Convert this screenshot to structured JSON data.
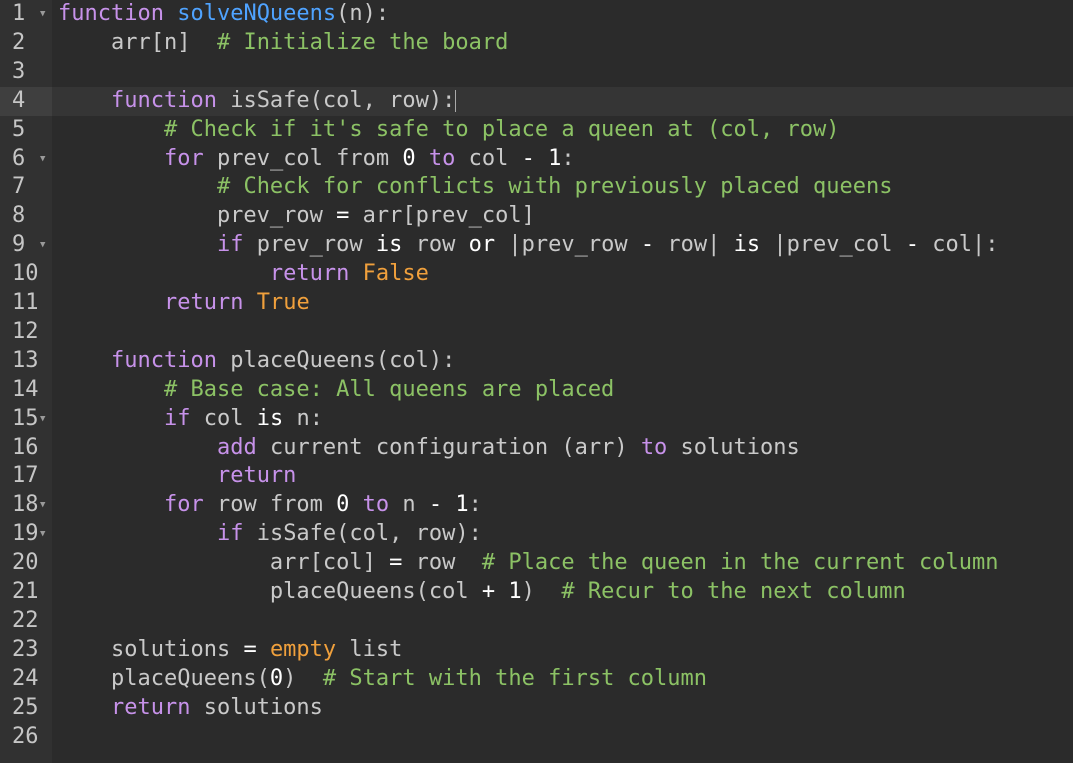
{
  "editor": {
    "colors": {
      "background": "#2b2b2b",
      "gutter": "#313131",
      "keyword": "#c792ea",
      "function_name": "#4fa3ff",
      "comment": "#8cc265",
      "literal": "#f0a03c",
      "operator": "#ffffff",
      "default": "#c9c9c9"
    },
    "active_line": 4,
    "folded_markers": [
      1,
      6,
      9,
      15,
      18,
      19
    ],
    "lines": [
      {
        "number": "1",
        "tokens": [
          [
            "kw",
            "function"
          ],
          [
            "d",
            " "
          ],
          [
            "fn",
            "solveNQueens"
          ],
          [
            "d",
            "(n):"
          ]
        ]
      },
      {
        "number": "2",
        "tokens": [
          [
            "d",
            "    arr[n]  "
          ],
          [
            "cm",
            "# Initialize the board"
          ]
        ]
      },
      {
        "number": "3",
        "tokens": []
      },
      {
        "number": "4",
        "tokens": [
          [
            "d",
            "    "
          ],
          [
            "kw",
            "function"
          ],
          [
            "d",
            " isSafe(col, row):"
          ]
        ]
      },
      {
        "number": "5",
        "tokens": [
          [
            "d",
            "        "
          ],
          [
            "cm",
            "# Check if it's safe to place a queen at (col, row)"
          ]
        ]
      },
      {
        "number": "6",
        "tokens": [
          [
            "d",
            "        "
          ],
          [
            "kw",
            "for"
          ],
          [
            "d",
            " prev_col from "
          ],
          [
            "w",
            "0"
          ],
          [
            "d",
            " "
          ],
          [
            "kw",
            "to"
          ],
          [
            "d",
            " col "
          ],
          [
            "w",
            "-"
          ],
          [
            "d",
            " "
          ],
          [
            "w",
            "1"
          ],
          [
            "d",
            ":"
          ]
        ]
      },
      {
        "number": "7",
        "tokens": [
          [
            "d",
            "            "
          ],
          [
            "cm",
            "# Check for conflicts with previously placed queens"
          ]
        ]
      },
      {
        "number": "8",
        "tokens": [
          [
            "d",
            "            prev_row "
          ],
          [
            "w",
            "="
          ],
          [
            "d",
            " arr[prev_col]"
          ]
        ]
      },
      {
        "number": "9",
        "tokens": [
          [
            "d",
            "            "
          ],
          [
            "kw",
            "if"
          ],
          [
            "d",
            " prev_row "
          ],
          [
            "w",
            "is"
          ],
          [
            "d",
            " row "
          ],
          [
            "w",
            "or"
          ],
          [
            "d",
            " |prev_row "
          ],
          [
            "w",
            "-"
          ],
          [
            "d",
            " row| "
          ],
          [
            "w",
            "is"
          ],
          [
            "d",
            " |prev_col "
          ],
          [
            "w",
            "-"
          ],
          [
            "d",
            " col|:"
          ]
        ]
      },
      {
        "number": "10",
        "tokens": [
          [
            "d",
            "                "
          ],
          [
            "kw",
            "return"
          ],
          [
            "d",
            " "
          ],
          [
            "or",
            "False"
          ]
        ]
      },
      {
        "number": "11",
        "tokens": [
          [
            "d",
            "        "
          ],
          [
            "kw",
            "return"
          ],
          [
            "d",
            " "
          ],
          [
            "or",
            "True"
          ]
        ]
      },
      {
        "number": "12",
        "tokens": []
      },
      {
        "number": "13",
        "tokens": [
          [
            "d",
            "    "
          ],
          [
            "kw",
            "function"
          ],
          [
            "d",
            " placeQueens(col):"
          ]
        ]
      },
      {
        "number": "14",
        "tokens": [
          [
            "d",
            "        "
          ],
          [
            "cm",
            "# Base case: All queens are placed"
          ]
        ]
      },
      {
        "number": "15",
        "tokens": [
          [
            "d",
            "        "
          ],
          [
            "kw",
            "if"
          ],
          [
            "d",
            " col "
          ],
          [
            "w",
            "is"
          ],
          [
            "d",
            " n:"
          ]
        ]
      },
      {
        "number": "16",
        "tokens": [
          [
            "d",
            "            "
          ],
          [
            "kw",
            "add"
          ],
          [
            "d",
            " current configuration (arr) "
          ],
          [
            "kw",
            "to"
          ],
          [
            "d",
            " solutions"
          ]
        ]
      },
      {
        "number": "17",
        "tokens": [
          [
            "d",
            "            "
          ],
          [
            "kw",
            "return"
          ]
        ]
      },
      {
        "number": "18",
        "tokens": [
          [
            "d",
            "        "
          ],
          [
            "kw",
            "for"
          ],
          [
            "d",
            " row from "
          ],
          [
            "w",
            "0"
          ],
          [
            "d",
            " "
          ],
          [
            "kw",
            "to"
          ],
          [
            "d",
            " n "
          ],
          [
            "w",
            "-"
          ],
          [
            "d",
            " "
          ],
          [
            "w",
            "1"
          ],
          [
            "d",
            ":"
          ]
        ]
      },
      {
        "number": "19",
        "tokens": [
          [
            "d",
            "            "
          ],
          [
            "kw",
            "if"
          ],
          [
            "d",
            " isSafe(col, row):"
          ]
        ]
      },
      {
        "number": "20",
        "tokens": [
          [
            "d",
            "                arr[col] "
          ],
          [
            "w",
            "="
          ],
          [
            "d",
            " row  "
          ],
          [
            "cm",
            "# Place the queen in the current column"
          ]
        ]
      },
      {
        "number": "21",
        "tokens": [
          [
            "d",
            "                placeQueens(col "
          ],
          [
            "w",
            "+"
          ],
          [
            "d",
            " "
          ],
          [
            "w",
            "1"
          ],
          [
            "d",
            ")  "
          ],
          [
            "cm",
            "# Recur to the next column"
          ]
        ]
      },
      {
        "number": "22",
        "tokens": []
      },
      {
        "number": "23",
        "tokens": [
          [
            "d",
            "    solutions "
          ],
          [
            "w",
            "="
          ],
          [
            "d",
            " "
          ],
          [
            "or",
            "empty"
          ],
          [
            "d",
            " list"
          ]
        ]
      },
      {
        "number": "24",
        "tokens": [
          [
            "d",
            "    placeQueens("
          ],
          [
            "w",
            "0"
          ],
          [
            "d",
            ")  "
          ],
          [
            "cm",
            "# Start with the first column"
          ]
        ]
      },
      {
        "number": "25",
        "tokens": [
          [
            "d",
            "    "
          ],
          [
            "kw",
            "return"
          ],
          [
            "d",
            " solutions"
          ]
        ]
      },
      {
        "number": "26",
        "tokens": []
      }
    ]
  }
}
